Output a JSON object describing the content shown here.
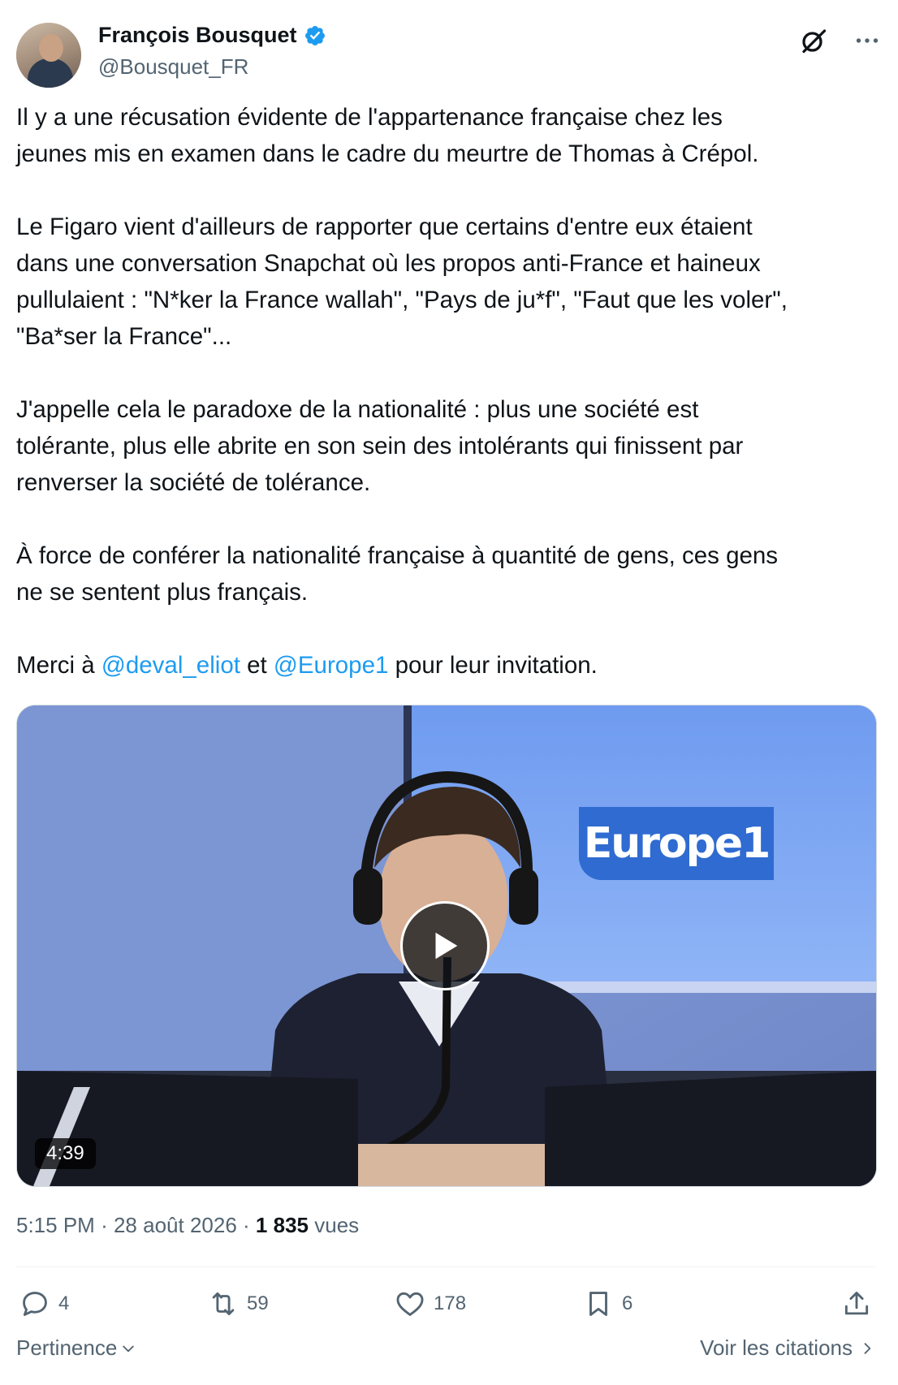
{
  "author": {
    "display_name": "François Bousquet",
    "handle": "@Bousquet_FR",
    "verified_color": "#1d9bf0"
  },
  "tweet": {
    "paragraphs": [
      "Il y a une récusation évidente de l'appartenance française chez les\njeunes mis en examen dans le cadre du meurtre de Thomas à Crépol.",
      "Le Figaro vient d'ailleurs de rapporter que certains d'entre eux étaient\ndans une conversation Snapchat où les propos anti-France et haineux\npullulaient : \"N*ker la France wallah\", \"Pays de ju*f\", \"Faut que les voler\",\n\"Ba*ser la France\"...",
      "J'appelle cela le paradoxe de la nationalité : plus une société est\ntolérante, plus elle abrite en son sein des intolérants qui finissent par\nrenverser la société de tolérance.",
      "À force de conférer la nationalité française à quantité de gens, ces gens\nne se sentent plus français."
    ],
    "closing": {
      "before": "Merci à ",
      "mention1": "@deval_eliot",
      "middle": " et ",
      "mention2": "@Europe1",
      "after": " pour leur invitation."
    },
    "link_color": "#1d9bf0"
  },
  "media": {
    "logo_text": "Europe1",
    "duration": "4:39",
    "play_icon": "play-icon"
  },
  "meta": {
    "time": "5:15 PM",
    "date": "28 août 2026",
    "separator": "·",
    "views_count": "1 835",
    "views_label": "vues"
  },
  "actions": {
    "replies": "4",
    "reposts": "59",
    "likes": "178",
    "bookmarks": "6"
  },
  "footer": {
    "sort_label": "Pertinence",
    "quotes_label": "Voir les citations"
  }
}
